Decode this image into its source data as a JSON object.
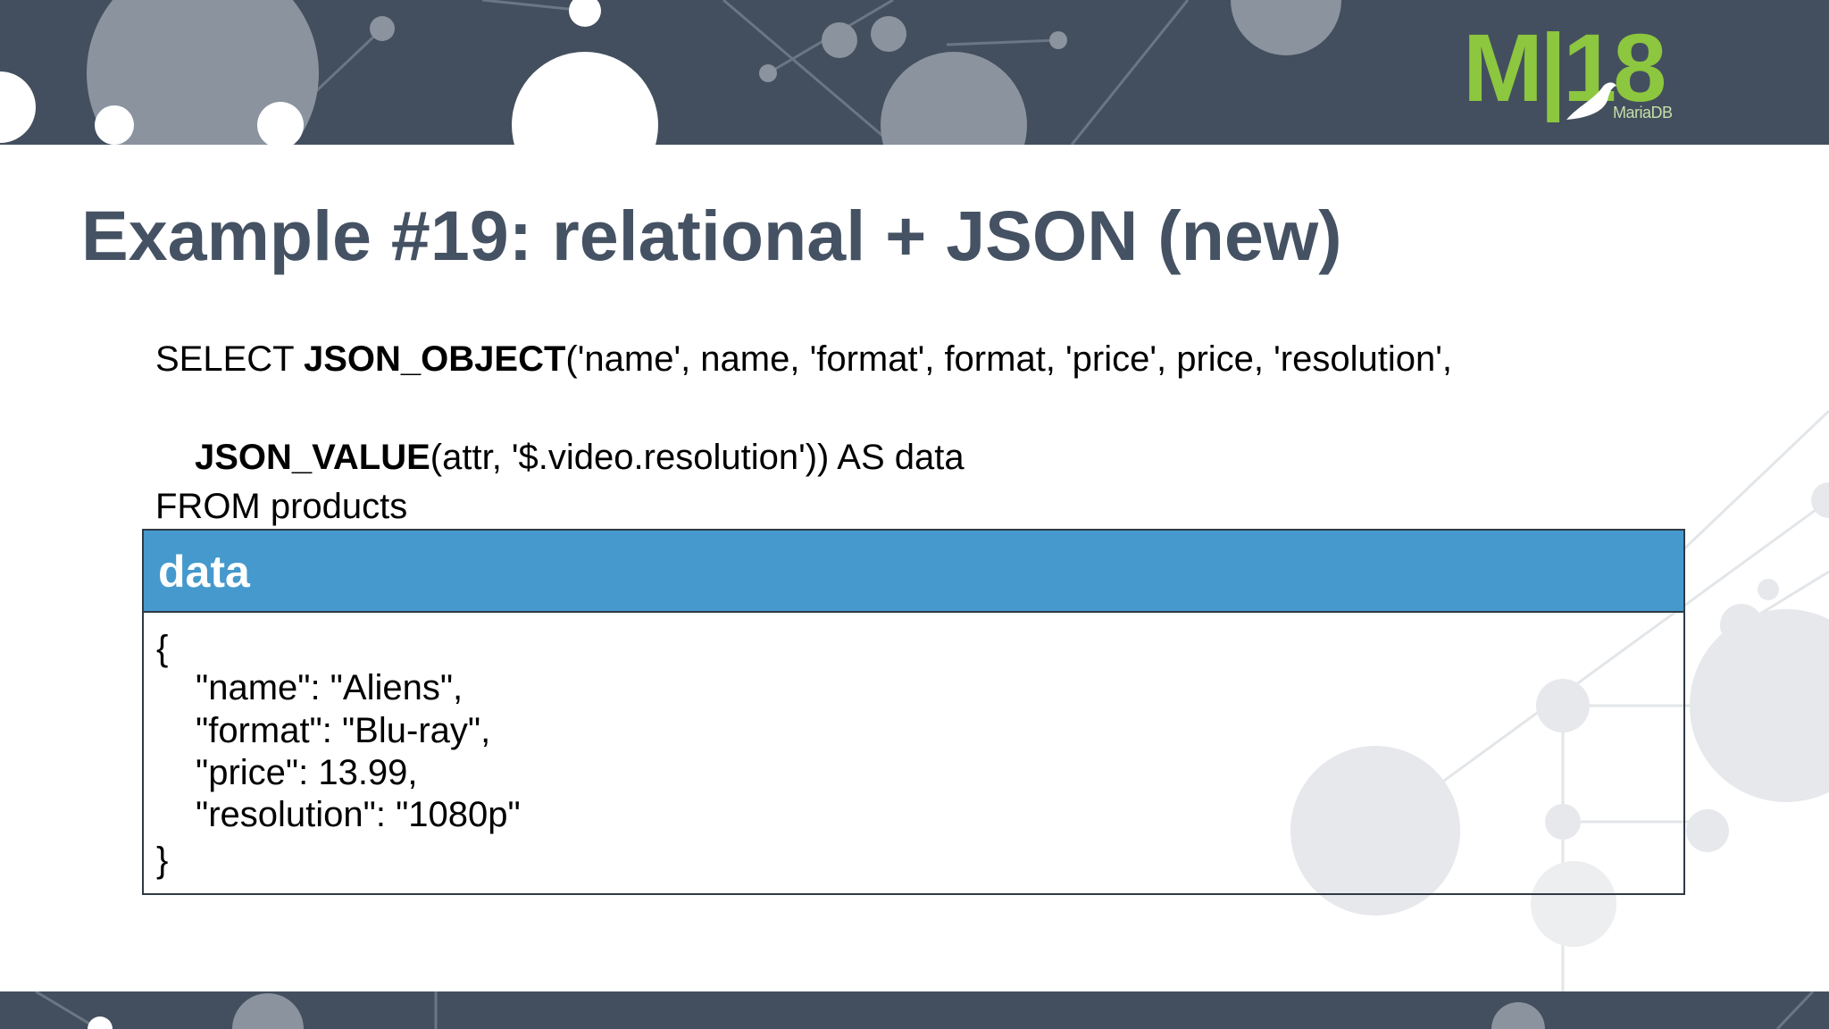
{
  "slide": {
    "title": "Example #19: relational + JSON (new)"
  },
  "logo": {
    "text": "M|18",
    "sub": "MariaDB"
  },
  "sql": {
    "line1_pre": "SELECT ",
    "line1_func": "JSON_OBJECT",
    "line1_args": "('name', name, 'format', format, 'price', price, 'resolution',",
    "line2_func": "JSON_VALUE",
    "line2_args": "(attr, '$.video.resolution')) AS data",
    "line3": "FROM products"
  },
  "result": {
    "column_header": "data",
    "lines": [
      "{",
      "\"name\": \"Aliens\",",
      "\"format\": \"Blu-ray\",",
      "\"price\": 13.99,",
      "\"resolution\": \"1080p\"",
      "}"
    ]
  },
  "colors": {
    "band": "#434f5e",
    "title": "#455263",
    "table_header": "#4599cc",
    "logo": "#8dc63f"
  }
}
